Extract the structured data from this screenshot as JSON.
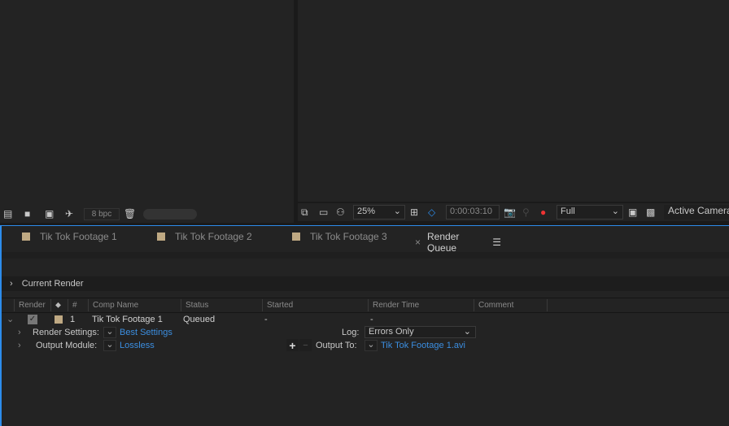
{
  "project_toolbar": {
    "bpc": "8 bpc"
  },
  "viewer_toolbar": {
    "zoom": "25%",
    "timecode": "0:00:03:10",
    "resolution": "Full",
    "camera": "Active Camera"
  },
  "tabs": [
    {
      "label": "Tik Tok Footage 1"
    },
    {
      "label": "Tik Tok Footage 2"
    },
    {
      "label": "Tik Tok Footage 3"
    },
    {
      "label": "Render Queue",
      "close": "×",
      "menu": "☰"
    }
  ],
  "current_render": "Current Render",
  "columns": {
    "render": "Render",
    "num": "#",
    "comp": "Comp Name",
    "status": "Status",
    "started": "Started",
    "render_time": "Render Time",
    "comment": "Comment"
  },
  "item": {
    "num": "1",
    "comp": "Tik Tok Footage 1",
    "status": "Queued",
    "started": "-",
    "render_time": "-",
    "render_settings_label": "Render Settings:",
    "render_settings": "Best Settings",
    "log_label": "Log:",
    "log": "Errors Only",
    "output_module_label": "Output Module:",
    "output_module": "Lossless",
    "output_to_label": "Output To:",
    "output_to": "Tik Tok Footage 1.avi"
  },
  "colors": {
    "accent": "#2d8ceb",
    "label": "#bfa983"
  }
}
